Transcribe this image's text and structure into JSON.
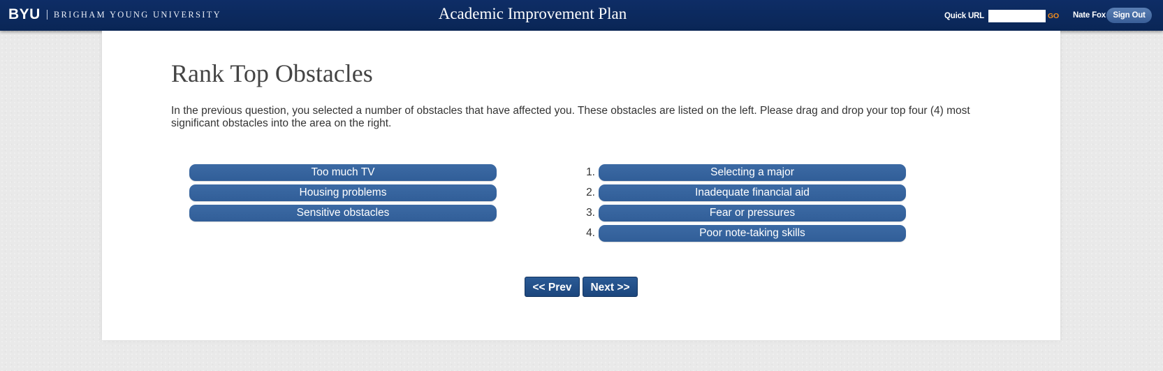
{
  "header": {
    "logo": "BYU",
    "university": "BRIGHAM YOUNG UNIVERSITY",
    "title": "Academic Improvement Plan",
    "quick_url_label": "Quick URL",
    "quick_url_value": "",
    "go_label": "GO",
    "user_name": "Nate Fox",
    "signout_label": "Sign Out"
  },
  "main": {
    "title": "Rank Top Obstacles",
    "instructions": "In the previous question, you selected a number of obstacles that have affected you. These obstacles are listed on the left. Please drag and drop your top four (4) most significant obstacles into the area on the right.",
    "available": [
      "Too much TV",
      "Housing problems",
      "Sensitive obstacles"
    ],
    "ranked": [
      {
        "rank": "1.",
        "label": "Selecting a major"
      },
      {
        "rank": "2.",
        "label": "Inadequate financial aid"
      },
      {
        "rank": "3.",
        "label": "Fear or pressures"
      },
      {
        "rank": "4.",
        "label": "Poor note-taking skills"
      }
    ],
    "prev_label": "<< Prev",
    "next_label": "Next >>"
  },
  "colors": {
    "header_bg": "#0a2656",
    "pill_bg": "#315e98",
    "go_accent": "#f28c1c",
    "button_bg": "#1c467d"
  }
}
